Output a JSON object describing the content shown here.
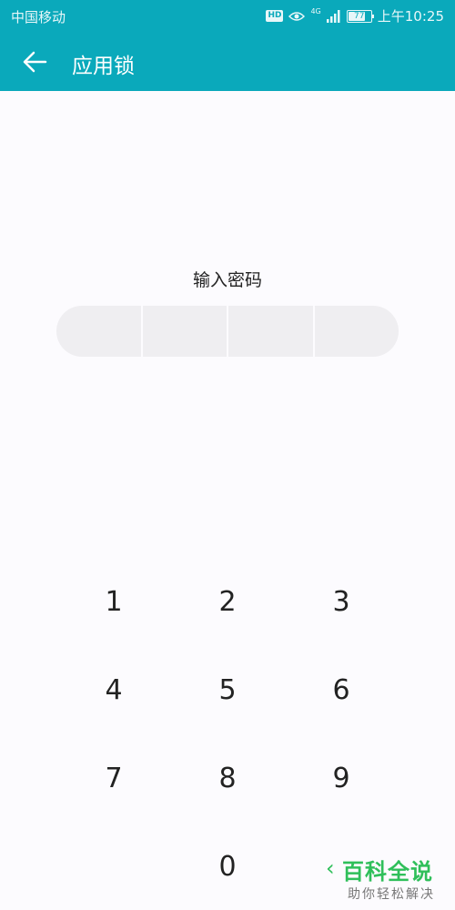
{
  "status_bar": {
    "carrier": "中国移动",
    "hd": "HD",
    "network": "4G",
    "battery": "77",
    "battery_level_percent": 77,
    "time": "上午10:25"
  },
  "header": {
    "title": "应用锁",
    "back_icon": "arrow-left-icon"
  },
  "lock": {
    "prompt": "输入密码",
    "digits_entered": 0,
    "pin_length": 4
  },
  "keypad": {
    "keys": [
      "1",
      "2",
      "3",
      "4",
      "5",
      "6",
      "7",
      "8",
      "9",
      "0"
    ]
  },
  "watermark": {
    "title": "百科全说",
    "subtitle": "助你轻松解决"
  },
  "colors": {
    "header": "#0aa9bb",
    "background": "#fcfbfe",
    "pin_cell": "#efeef1",
    "watermark": "#2fbf5a"
  }
}
